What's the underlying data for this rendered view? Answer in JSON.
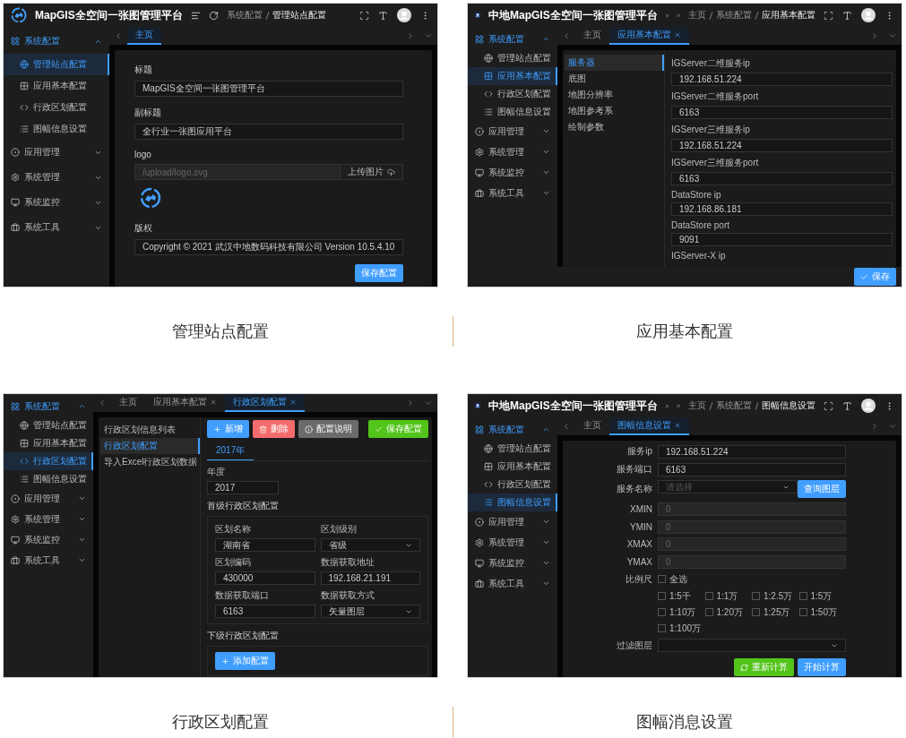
{
  "panels": [
    {
      "kind": "site",
      "caption": "管理站点配置",
      "header": {
        "title": "MapGIS全空间一张图管理平台",
        "breadcrumb": [
          "系统配置",
          "管理站点配置"
        ]
      },
      "sidebar": [
        {
          "label": "系统配置",
          "expanded": true,
          "children": [
            {
              "label": "管理站点配置",
              "selected": true
            },
            {
              "label": "应用基本配置",
              "selected": false
            },
            {
              "label": "行政区划配置",
              "selected": false
            },
            {
              "label": "图幅信息设置",
              "selected": false
            }
          ]
        },
        {
          "label": "应用管理",
          "expanded": false
        },
        {
          "label": "系统管理",
          "expanded": false
        },
        {
          "label": "系统监控",
          "expanded": false
        },
        {
          "label": "系统工具",
          "expanded": false
        }
      ],
      "tabs": [
        {
          "label": "主页",
          "selected": true,
          "closable": false
        }
      ],
      "fields": [
        {
          "label": "标题",
          "value": "MapGIS全空间一张图管理平台",
          "disabled": false
        },
        {
          "label": "副标题",
          "value": "全行业一张图应用平台",
          "disabled": false
        },
        {
          "label": "logo",
          "value": "/upload/logo.svg",
          "disabled": true,
          "button": "上传图片"
        },
        {
          "label": "版权",
          "value": "Copyright © 2021 武汉中地数码科技有限公司 Version 10.5.4.10",
          "disabled": false
        }
      ],
      "save": "保存配置"
    },
    {
      "kind": "app",
      "caption": "应用基本配置",
      "header": {
        "title": "中地MapGIS全空间一张图管理平台",
        "breadcrumb": [
          "主页",
          "系统配置",
          "应用基本配置"
        ]
      },
      "sidebar": [
        {
          "label": "系统配置",
          "expanded": true,
          "children": [
            {
              "label": "管理站点配置",
              "selected": false
            },
            {
              "label": "应用基本配置",
              "selected": true
            },
            {
              "label": "行政区划配置",
              "selected": false
            },
            {
              "label": "图幅信息设置",
              "selected": false
            }
          ]
        },
        {
          "label": "应用管理",
          "expanded": false
        },
        {
          "label": "系统管理",
          "expanded": false
        },
        {
          "label": "系统监控",
          "expanded": false
        },
        {
          "label": "系统工具",
          "expanded": false
        }
      ],
      "tabs": [
        {
          "label": "主页",
          "selected": false,
          "closable": false
        },
        {
          "label": "应用基本配置",
          "selected": true,
          "closable": true
        }
      ],
      "submenu": [
        {
          "label": "服务器",
          "selected": true
        },
        {
          "label": "底图",
          "selected": false
        },
        {
          "label": "地图分辨率",
          "selected": false
        },
        {
          "label": "地图参考系",
          "selected": false
        },
        {
          "label": "绘制参数",
          "selected": false
        }
      ],
      "fields": [
        {
          "label": "IGServer二维服务ip",
          "value": "192.168.51.224"
        },
        {
          "label": "IGServer二维服务port",
          "value": "6163"
        },
        {
          "label": "IGServer三维服务ip",
          "value": "192.168.51.224"
        },
        {
          "label": "IGServer三维服务port",
          "value": "6163"
        },
        {
          "label": "DataStore ip",
          "value": "192.168.86.181"
        },
        {
          "label": "DataStore port",
          "value": "9091"
        },
        {
          "label": "IGServer-X ip"
        }
      ],
      "save": "保存"
    },
    {
      "kind": "region",
      "caption": "行政区划配置",
      "sidebar": [
        {
          "label": "系统配置",
          "expanded": true,
          "children": [
            {
              "label": "管理站点配置",
              "selected": false
            },
            {
              "label": "应用基本配置",
              "selected": false
            },
            {
              "label": "行政区划配置",
              "selected": true
            },
            {
              "label": "图幅信息设置",
              "selected": false
            }
          ]
        },
        {
          "label": "应用管理",
          "expanded": false
        },
        {
          "label": "系统管理",
          "expanded": false
        },
        {
          "label": "系统监控",
          "expanded": false
        },
        {
          "label": "系统工具",
          "expanded": false
        }
      ],
      "tabs": [
        {
          "label": "主页",
          "selected": false,
          "closable": false
        },
        {
          "label": "应用基本配置",
          "selected": false,
          "closable": true
        },
        {
          "label": "行政区划配置",
          "selected": true,
          "closable": true
        }
      ],
      "submenu": [
        {
          "label": "行政区划信息列表",
          "selected": false
        },
        {
          "label": "行政区划配置",
          "selected": true
        },
        {
          "label": "导入Excel行政区划数据",
          "selected": false
        }
      ],
      "toolbar": [
        {
          "label": "新增",
          "kind": "add"
        },
        {
          "label": "删除",
          "kind": "delete"
        },
        {
          "label": "配置说明",
          "kind": "info"
        }
      ],
      "save": "保存配置",
      "year_tabs": [
        {
          "label": "2017年",
          "selected": true
        }
      ],
      "year": {
        "label": "年度",
        "value": "2017"
      },
      "primary": {
        "title": "首级行政区划配置",
        "fields": [
          {
            "label": "区划名称",
            "value": "湖南省",
            "kind": "input"
          },
          {
            "label": "区划级别",
            "value": "省级",
            "kind": "select"
          },
          {
            "label": "区划编码",
            "value": "430000",
            "kind": "input"
          },
          {
            "label": "数据获取地址",
            "value": "192.168.21.191",
            "kind": "input"
          },
          {
            "label": "数据获取端口",
            "value": "6163",
            "kind": "input"
          },
          {
            "label": "数据获取方式",
            "value": "矢量图层",
            "kind": "select"
          }
        ]
      },
      "secondary": {
        "title": "下级行政区划配置",
        "button": "添加配置"
      }
    },
    {
      "kind": "mapsheet",
      "caption": "图幅消息设置",
      "header": {
        "title": "中地MapGIS全空间一张图管理平台",
        "breadcrumb": [
          "主页",
          "系统配置",
          "图幅信息设置"
        ]
      },
      "sidebar": [
        {
          "label": "系统配置",
          "expanded": true,
          "children": [
            {
              "label": "管理站点配置",
              "selected": false
            },
            {
              "label": "应用基本配置",
              "selected": false
            },
            {
              "label": "行政区划配置",
              "selected": false
            },
            {
              "label": "图幅信息设置",
              "selected": true
            }
          ]
        },
        {
          "label": "应用管理",
          "expanded": false
        },
        {
          "label": "系统管理",
          "expanded": false
        },
        {
          "label": "系统监控",
          "expanded": false
        },
        {
          "label": "系统工具",
          "expanded": false
        }
      ],
      "tabs": [
        {
          "label": "主页",
          "selected": false,
          "closable": false
        },
        {
          "label": "图幅信息设置",
          "selected": true,
          "closable": true
        }
      ],
      "fields": [
        {
          "label": "服务ip",
          "value": "192.168.51.224",
          "kind": "input",
          "disabled": false
        },
        {
          "label": "服务端口",
          "value": "6163",
          "kind": "input",
          "disabled": false
        },
        {
          "label": "服务名称",
          "placeholder": "请选择",
          "kind": "select",
          "button": "查询图层",
          "disabled": false
        },
        {
          "label": "XMIN",
          "value": "0",
          "kind": "input",
          "disabled": true
        },
        {
          "label": "YMIN",
          "value": "0",
          "kind": "input",
          "disabled": true
        },
        {
          "label": "XMAX",
          "value": "0",
          "kind": "input",
          "disabled": true
        },
        {
          "label": "YMAX",
          "value": "0",
          "kind": "input",
          "disabled": true
        }
      ],
      "scale": {
        "label": "比例尺",
        "all": {
          "label": "全选",
          "checked": false
        },
        "options": [
          {
            "label": "1:5千",
            "checked": false
          },
          {
            "label": "1:1万",
            "checked": false
          },
          {
            "label": "1:2.5万",
            "checked": false
          },
          {
            "label": "1:5万",
            "checked": false
          },
          {
            "label": "1:10万",
            "checked": false
          },
          {
            "label": "1:20万",
            "checked": false
          },
          {
            "label": "1:25万",
            "checked": false
          },
          {
            "label": "1:50万",
            "checked": false
          },
          {
            "label": "1:100万",
            "checked": false
          }
        ]
      },
      "filter": {
        "label": "过滤图层"
      },
      "buttons": [
        {
          "label": "重新计算",
          "kind": "reset"
        },
        {
          "label": "开始计算",
          "kind": "primary"
        }
      ]
    }
  ]
}
